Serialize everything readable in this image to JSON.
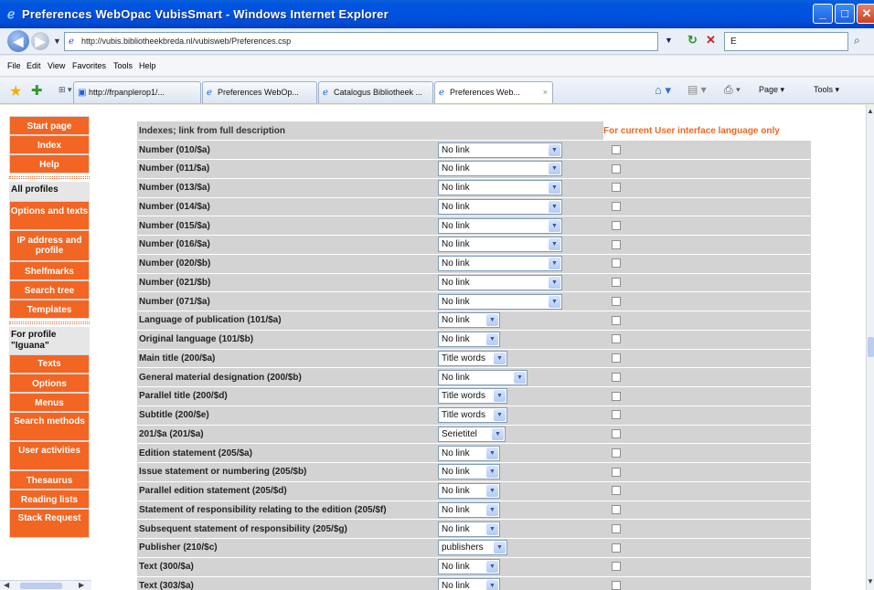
{
  "window": {
    "title": "Preferences WebOpac VubisSmart - Windows Internet Explorer"
  },
  "address": {
    "url": "http://vubis.bibliotheekbreda.nl/vubisweb/Preferences.csp",
    "search_value": "E"
  },
  "menu": [
    "File",
    "Edit",
    "View",
    "Favorites",
    "Tools",
    "Help"
  ],
  "tabs": [
    {
      "label": "http://frpanplerop1/...",
      "active": false
    },
    {
      "label": "Preferences WebOp...",
      "active": false
    },
    {
      "label": "Catalogus Bibliotheek ...",
      "active": false
    },
    {
      "label": "Preferences Web...",
      "active": true
    }
  ],
  "command_bar": {
    "page_label": "Page",
    "tools_label": "Tools"
  },
  "sidebar": {
    "top_buttons": [
      "Start page",
      "Index",
      "Help"
    ],
    "all_profiles_label": "All profiles",
    "profile_buttons": [
      "Options and texts",
      "IP address and profile",
      "Shelfmarks",
      "Search tree",
      "Templates"
    ],
    "for_profile_label": "For profile \"Iguana\"",
    "iguana_buttons": [
      "Texts",
      "Options",
      "Menus",
      "Search methods",
      "User activities",
      "Thesaurus",
      "Reading lists",
      "Stack Request"
    ]
  },
  "table": {
    "header": "Indexes; link from full description",
    "language_column": "For current User interface language only",
    "rows": [
      {
        "label": "Number   (010/$a)",
        "value": "No link"
      },
      {
        "label": "Number   (011/$a)",
        "value": "No link"
      },
      {
        "label": "Number   (013/$a)",
        "value": "No link"
      },
      {
        "label": "Number   (014/$a)",
        "value": "No link"
      },
      {
        "label": "Number   (015/$a)",
        "value": "No link"
      },
      {
        "label": "Number   (016/$a)",
        "value": "No link"
      },
      {
        "label": "Number   (020/$b)",
        "value": "No link"
      },
      {
        "label": "Number   (021/$b)",
        "value": "No link"
      },
      {
        "label": "Number   (071/$a)",
        "value": "No link"
      },
      {
        "label": "Language of publication   (101/$a)",
        "value": "No link"
      },
      {
        "label": "Original language   (101/$b)",
        "value": "No link"
      },
      {
        "label": "Main title   (200/$a)",
        "value": "Title words"
      },
      {
        "label": "General material designation   (200/$b)",
        "value": "No link"
      },
      {
        "label": "Parallel title   (200/$d)",
        "value": "Title words"
      },
      {
        "label": "Subtitle   (200/$e)",
        "value": "Title words"
      },
      {
        "label": "201/$a   (201/$a)",
        "value": "Serietitel"
      },
      {
        "label": "Edition statement   (205/$a)",
        "value": "No link"
      },
      {
        "label": "Issue statement or numbering   (205/$b)",
        "value": "No link"
      },
      {
        "label": "Parallel edition statement   (205/$d)",
        "value": "No link"
      },
      {
        "label": "Statement of responsibility relating to the edition   (205/$f)",
        "value": "No link"
      },
      {
        "label": "Subsequent statement of responsibility   (205/$g)",
        "value": "No link"
      },
      {
        "label": "Publisher   (210/$c)",
        "value": "publishers"
      },
      {
        "label": "Text   (300/$a)",
        "value": "No link"
      },
      {
        "label": "Text   (303/$a)",
        "value": "No link"
      }
    ]
  }
}
